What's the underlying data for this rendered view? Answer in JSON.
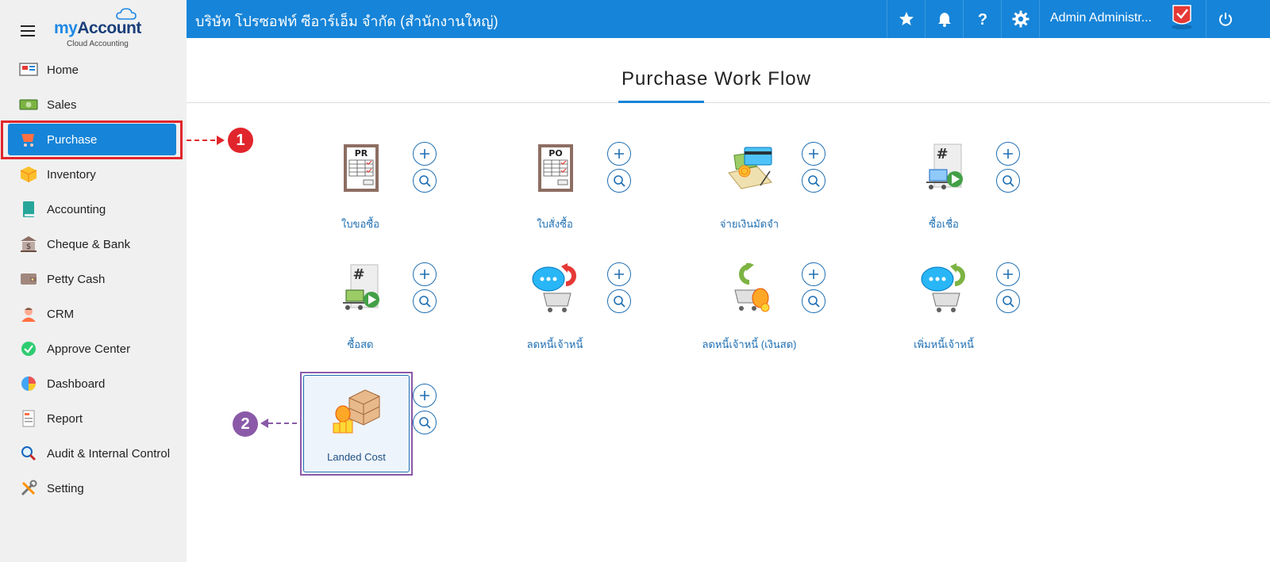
{
  "app": {
    "brand_my": "my",
    "brand_account": "Account",
    "brand_sub": "Cloud Accounting"
  },
  "sidebar": {
    "items": [
      {
        "label": "Home",
        "icon": "home-icon"
      },
      {
        "label": "Sales",
        "icon": "sales-icon"
      },
      {
        "label": "Purchase",
        "icon": "purchase-cart-icon",
        "active": true
      },
      {
        "label": "Inventory",
        "icon": "inventory-box-icon"
      },
      {
        "label": "Accounting",
        "icon": "accounting-book-icon"
      },
      {
        "label": "Cheque & Bank",
        "icon": "bank-icon"
      },
      {
        "label": "Petty Cash",
        "icon": "wallet-icon"
      },
      {
        "label": "CRM",
        "icon": "crm-person-icon"
      },
      {
        "label": "Approve Center",
        "icon": "check-circle-icon"
      },
      {
        "label": "Dashboard",
        "icon": "pie-chart-icon"
      },
      {
        "label": "Report",
        "icon": "report-icon"
      },
      {
        "label": "Audit & Internal Control",
        "icon": "magnifier-icon"
      },
      {
        "label": "Setting",
        "icon": "tools-icon"
      }
    ]
  },
  "topbar": {
    "company": "บริษัท โปรซอฟท์ ซีอาร์เอ็ม จำกัด (สำนักงานใหญ่)",
    "user": "Admin Administr...",
    "icons": [
      "star-icon",
      "bell-icon",
      "help-icon",
      "gear-icon",
      "user-avatar",
      "power-icon"
    ]
  },
  "main": {
    "title": "Purchase Work Flow",
    "cards": [
      {
        "label": "ใบขอซื้อ",
        "icon": "purchase-requisition-icon",
        "doc_code": "PR"
      },
      {
        "label": "ใบสั่งซื้อ",
        "icon": "purchase-order-icon",
        "doc_code": "PO"
      },
      {
        "label": "จ่ายเงินมัดจำ",
        "icon": "deposit-payment-icon"
      },
      {
        "label": "ซื้อเชื่อ",
        "icon": "credit-purchase-icon",
        "doc_code": "#"
      },
      {
        "label": "ซื้อสด",
        "icon": "cash-purchase-icon",
        "doc_code": "#"
      },
      {
        "label": "ลดหนี้เจ้าหนี้",
        "icon": "creditor-debit-note-icon"
      },
      {
        "label": "ลดหนี้เจ้าหนี้ (เงินสด)",
        "icon": "creditor-debit-note-cash-icon"
      },
      {
        "label": "เพิ่มหนี้เจ้าหนี้",
        "icon": "creditor-increase-debt-icon"
      }
    ],
    "landed_cost": {
      "label": "Landed Cost",
      "icon": "landed-cost-icon"
    }
  },
  "annotations": {
    "step1": "1",
    "step2": "2"
  },
  "colors": {
    "primary": "#1684d8",
    "highlight_red": "#e1252c",
    "highlight_purple": "#8a5aa8",
    "link": "#1f6fb2"
  }
}
